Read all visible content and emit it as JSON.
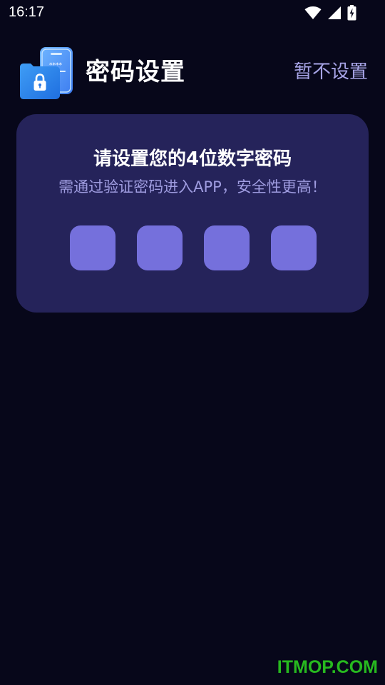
{
  "status_bar": {
    "time": "16:17",
    "icons": [
      "wifi-icon",
      "cellular-signal-icon",
      "battery-charging-icon"
    ]
  },
  "header": {
    "logo_icon": "password-phone-lock-icon",
    "title": "密码设置",
    "skip_label": "暂不设置"
  },
  "card": {
    "title": "请设置您的4位数字密码",
    "subtitle": "需通过验证密码进入APP，安全性更高！",
    "pin_length": 4
  },
  "watermark": "ITMOP.COM",
  "colors": {
    "background": "#07071a",
    "card": "#25235a",
    "pin_box": "#7570dc",
    "accent_text": "#a7a4e6",
    "watermark": "#27b91f"
  }
}
